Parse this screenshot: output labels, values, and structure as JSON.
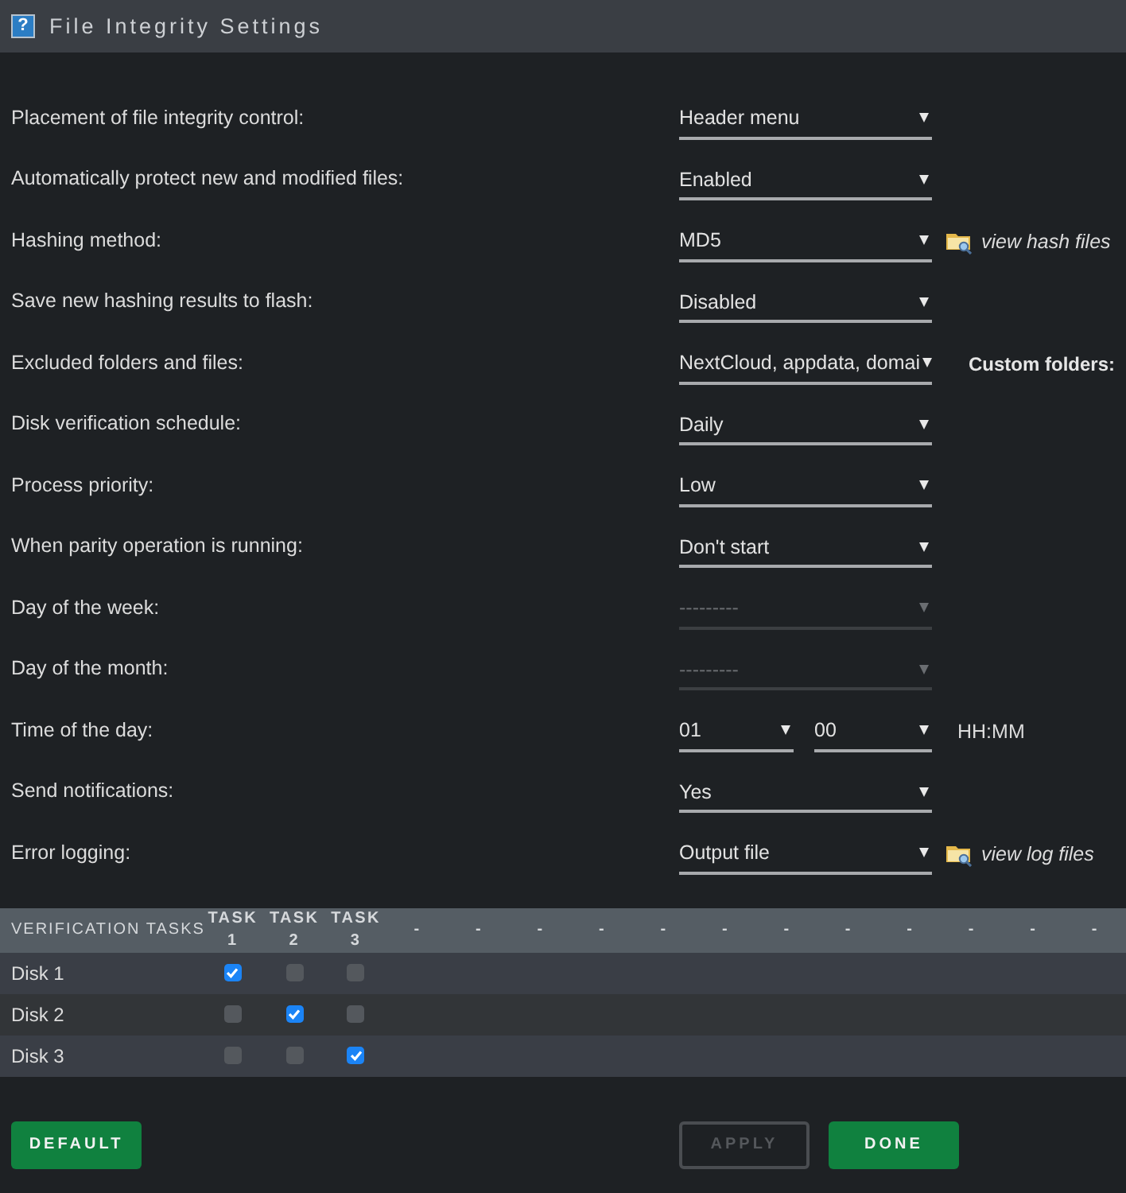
{
  "window": {
    "icon": "?",
    "title": "File Integrity Settings"
  },
  "settings": [
    {
      "label": "Placement of file integrity control:",
      "kind": "select",
      "value": "Header menu",
      "disabled": false
    },
    {
      "label": "Automatically protect new and modified files:",
      "kind": "select",
      "value": "Enabled",
      "disabled": false
    },
    {
      "label": "Hashing method:",
      "kind": "select",
      "value": "MD5",
      "disabled": false,
      "link": "view hash files"
    },
    {
      "label": "Save new hashing results to flash:",
      "kind": "select",
      "value": "Disabled",
      "disabled": false
    },
    {
      "label": "Excluded folders and files:",
      "kind": "select",
      "value": "NextCloud, appdata, domai",
      "disabled": false,
      "note": "Custom folders:"
    },
    {
      "label": "Disk verification schedule:",
      "kind": "select",
      "value": "Daily",
      "disabled": false
    },
    {
      "label": "Process priority:",
      "kind": "select",
      "value": "Low",
      "disabled": false
    },
    {
      "label": "When parity operation is running:",
      "kind": "select",
      "value": "Don't start",
      "disabled": false
    },
    {
      "label": "Day of the week:",
      "kind": "select",
      "value": "---------",
      "disabled": true
    },
    {
      "label": "Day of the month:",
      "kind": "select",
      "value": "---------",
      "disabled": true
    },
    {
      "label": "Time of the day:",
      "kind": "time",
      "fields": [
        {
          "value": "01"
        },
        {
          "value": "00"
        }
      ],
      "hint": "HH:MM"
    },
    {
      "label": "Send notifications:",
      "kind": "select",
      "value": "Yes",
      "disabled": false
    },
    {
      "label": "Error logging:",
      "kind": "select",
      "value": "Output file",
      "disabled": false,
      "link": "view log files"
    }
  ],
  "tasks": {
    "title": "VERIFICATION TASKS",
    "columns": [
      "TASK 1",
      "TASK 2",
      "TASK 3",
      "-",
      "-",
      "-",
      "-",
      "-",
      "-",
      "-",
      "-",
      "-",
      "-",
      "-",
      "-"
    ],
    "rows": [
      {
        "name": "Disk 1",
        "cells": [
          {
            "checked": true
          },
          {
            "checked": false
          },
          {
            "checked": false
          }
        ]
      },
      {
        "name": "Disk 2",
        "cells": [
          {
            "checked": false
          },
          {
            "checked": true
          },
          {
            "checked": false
          }
        ]
      },
      {
        "name": "Disk 3",
        "cells": [
          {
            "checked": false
          },
          {
            "checked": false
          },
          {
            "checked": true
          }
        ]
      }
    ]
  },
  "buttons": [
    {
      "label": "DEFAULT",
      "disabled": false,
      "kind": "reset"
    },
    {
      "label": "APPLY",
      "disabled": true,
      "kind": "submit"
    },
    {
      "label": "DONE",
      "disabled": false,
      "kind": "submit"
    }
  ]
}
